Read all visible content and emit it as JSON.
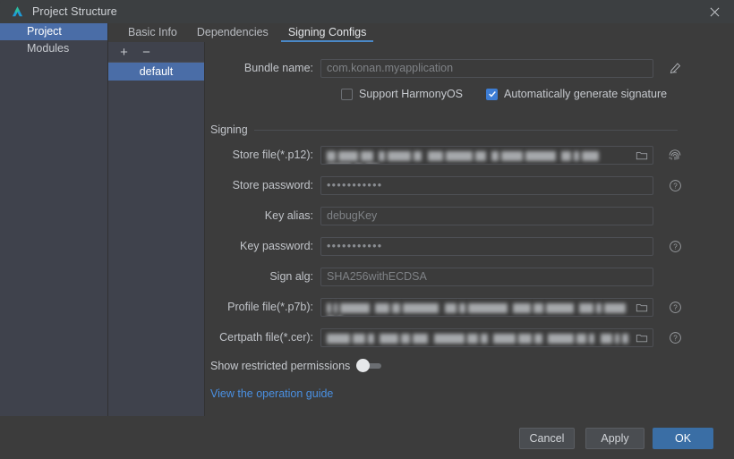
{
  "window": {
    "title": "Project Structure",
    "logo_icon": "deveco-studio-logo-icon",
    "close_icon": "close-icon"
  },
  "sidebar": {
    "items": [
      {
        "label": "Project",
        "selected": true
      },
      {
        "label": "Modules",
        "selected": false
      }
    ]
  },
  "tabs": [
    {
      "label": "Basic Info",
      "active": false
    },
    {
      "label": "Dependencies",
      "active": false
    },
    {
      "label": "Signing Configs",
      "active": true
    }
  ],
  "configs_panel": {
    "add_icon": "plus-icon",
    "remove_icon": "minus-icon",
    "add_label": "+",
    "remove_label": "−",
    "items": [
      {
        "label": "default",
        "selected": true
      }
    ]
  },
  "form": {
    "bundle_name": {
      "label": "Bundle name:",
      "value": "com.konan.myapplication",
      "edit_icon": "pencil-edit-icon"
    },
    "support_harmonyos": {
      "label": "Support HarmonyOS",
      "checked": false
    },
    "auto_generate_signature": {
      "label": "Automatically generate signature",
      "checked": true
    },
    "signing_group_title": "Signing",
    "store_file": {
      "label": "Store file(*.p12):",
      "value": "",
      "redacted": true,
      "folder_icon": "folder-browse-icon",
      "side_icon": "fingerprint-icon"
    },
    "store_password": {
      "label": "Store password:",
      "value": "•••••••••••",
      "side_icon": "help-circle-icon"
    },
    "key_alias": {
      "label": "Key alias:",
      "value": "debugKey"
    },
    "key_password": {
      "label": "Key password:",
      "value": "•••••••••••",
      "side_icon": "help-circle-icon"
    },
    "sign_alg": {
      "label": "Sign alg:",
      "value": "SHA256withECDSA"
    },
    "profile_file": {
      "label": "Profile file(*.p7b):",
      "value": "",
      "redacted": true,
      "folder_icon": "folder-browse-icon",
      "side_icon": "help-circle-icon"
    },
    "certpath_file": {
      "label": "Certpath file(*.cer):",
      "value": "",
      "redacted": true,
      "folder_icon": "folder-browse-icon",
      "side_icon": "help-circle-icon"
    },
    "show_restricted_permissions": {
      "label": "Show restricted permissions",
      "enabled": false
    },
    "operation_guide_link": "View the operation guide"
  },
  "footer": {
    "cancel_label": "Cancel",
    "apply_label": "Apply",
    "ok_label": "OK"
  },
  "colors": {
    "accent_blue": "#4a6da7",
    "tab_underline": "#4a88c7",
    "checkbox_checked": "#3d7dd4",
    "link_blue": "#4a90e2",
    "primary_button": "#3a6ea5",
    "panel_bg": "#3f424c",
    "main_bg": "#3c3c3c"
  }
}
